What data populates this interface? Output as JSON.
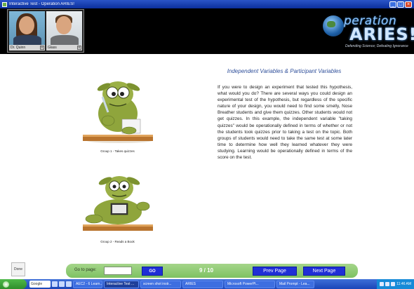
{
  "window": {
    "title": "Interactive Test - Operation ARIES!",
    "minimize": "_",
    "maximize": "□",
    "close": "×"
  },
  "avatars": [
    {
      "name": "Dr. Quinn",
      "control": "≡"
    },
    {
      "name": "Glass",
      "control": "≡"
    }
  ],
  "logo": {
    "top": "peration",
    "main": "ARIES!",
    "tagline": "Defending Science; Defeating Ignorance"
  },
  "content": {
    "heading": "Independent Variables & Participant Variables",
    "paragraph": "If you were to design an experiment that tested this hypothesis, what would you do? There are several ways you could design an experimental test of the hypothesis, but regardless of the specific nature of your design, you would need to find some smelly, Nose Breather students and give them quizzes.  Other students would not get quizzes.  In this example, the independent variable \"taking quizzes\" would be operationally defined in terms of whether or not the students took quizzes prior to taking a test on the topic. Both groups of students would need to take the same test at some later time to determine how well they learned whatever they were studying. Learning would be operationally defined in terms of the score on the test.",
    "figure1_caption": "Group 1 - Takes quizzes",
    "figure2_caption": "Group 2 - Reads a Book"
  },
  "nav": {
    "done_label": "Done",
    "goto_label": "Go to page:",
    "goto_value": "",
    "go_label": "GO",
    "page_indicator": "9 / 10",
    "prev_label": "Prev Page",
    "next_label": "Next Page"
  },
  "taskbar": {
    "start": "",
    "google": "Google",
    "tasks": [
      "AEC2 - 6 Learn...",
      "Interactive Test ...",
      "screen shot instr...",
      "ARIES",
      "Microsoft PowerPt...",
      "Mail Prompt - Lea..."
    ],
    "clock": "11:46 AM"
  },
  "colors": {
    "nav_green": "#8cc96f",
    "nav_button_blue": "#1f2fd6",
    "heading_blue": "#2f4f9a",
    "header_black": "#000000"
  }
}
